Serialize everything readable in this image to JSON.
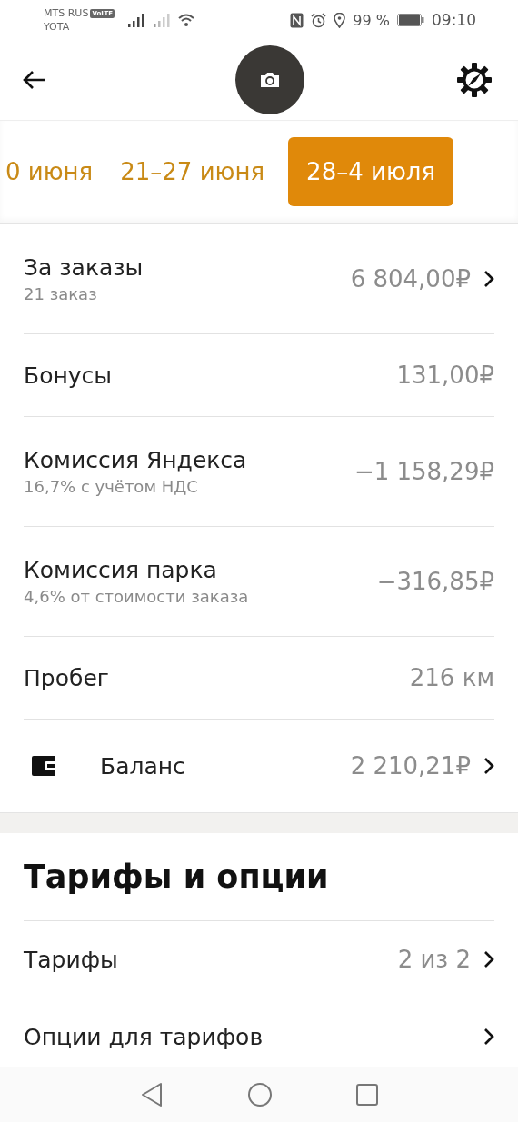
{
  "status_bar": {
    "carrier_1": "MTS RUS",
    "volte_badge": "VoLTE",
    "carrier_2": "YOTA",
    "battery": "99 %",
    "time": "09:10"
  },
  "weeks": [
    {
      "label": "0 июня",
      "selected": false
    },
    {
      "label": "21–27 июня",
      "selected": false
    },
    {
      "label": "28–4 июля",
      "selected": true
    }
  ],
  "rows": [
    {
      "kind": "line",
      "title": "За заказы",
      "subtitle": "21 заказ",
      "value": "6 804,00₽",
      "chevron": true
    },
    {
      "kind": "line",
      "title": "Бонусы",
      "value": "131,00₽",
      "chevron": false
    },
    {
      "kind": "line",
      "title": "Комиссия Яндекса",
      "subtitle": "16,7% с учётом НДС",
      "value": "−1 158,29₽",
      "chevron": false
    },
    {
      "kind": "line",
      "title": "Комиссия парка",
      "subtitle": "4,6% от стоимости заказа",
      "value": "−316,85₽",
      "chevron": false
    },
    {
      "kind": "line",
      "title": "Пробег",
      "value": "216 км",
      "chevron": false
    },
    {
      "kind": "wallet",
      "title": "Баланс",
      "value": "2 210,21₽",
      "chevron": true
    }
  ],
  "section": {
    "title": "Тарифы и опции",
    "rows": [
      {
        "title": "Тарифы",
        "value": "2 из 2",
        "chevron": true
      },
      {
        "title": "Опции для тарифов",
        "chevron": true
      }
    ]
  }
}
